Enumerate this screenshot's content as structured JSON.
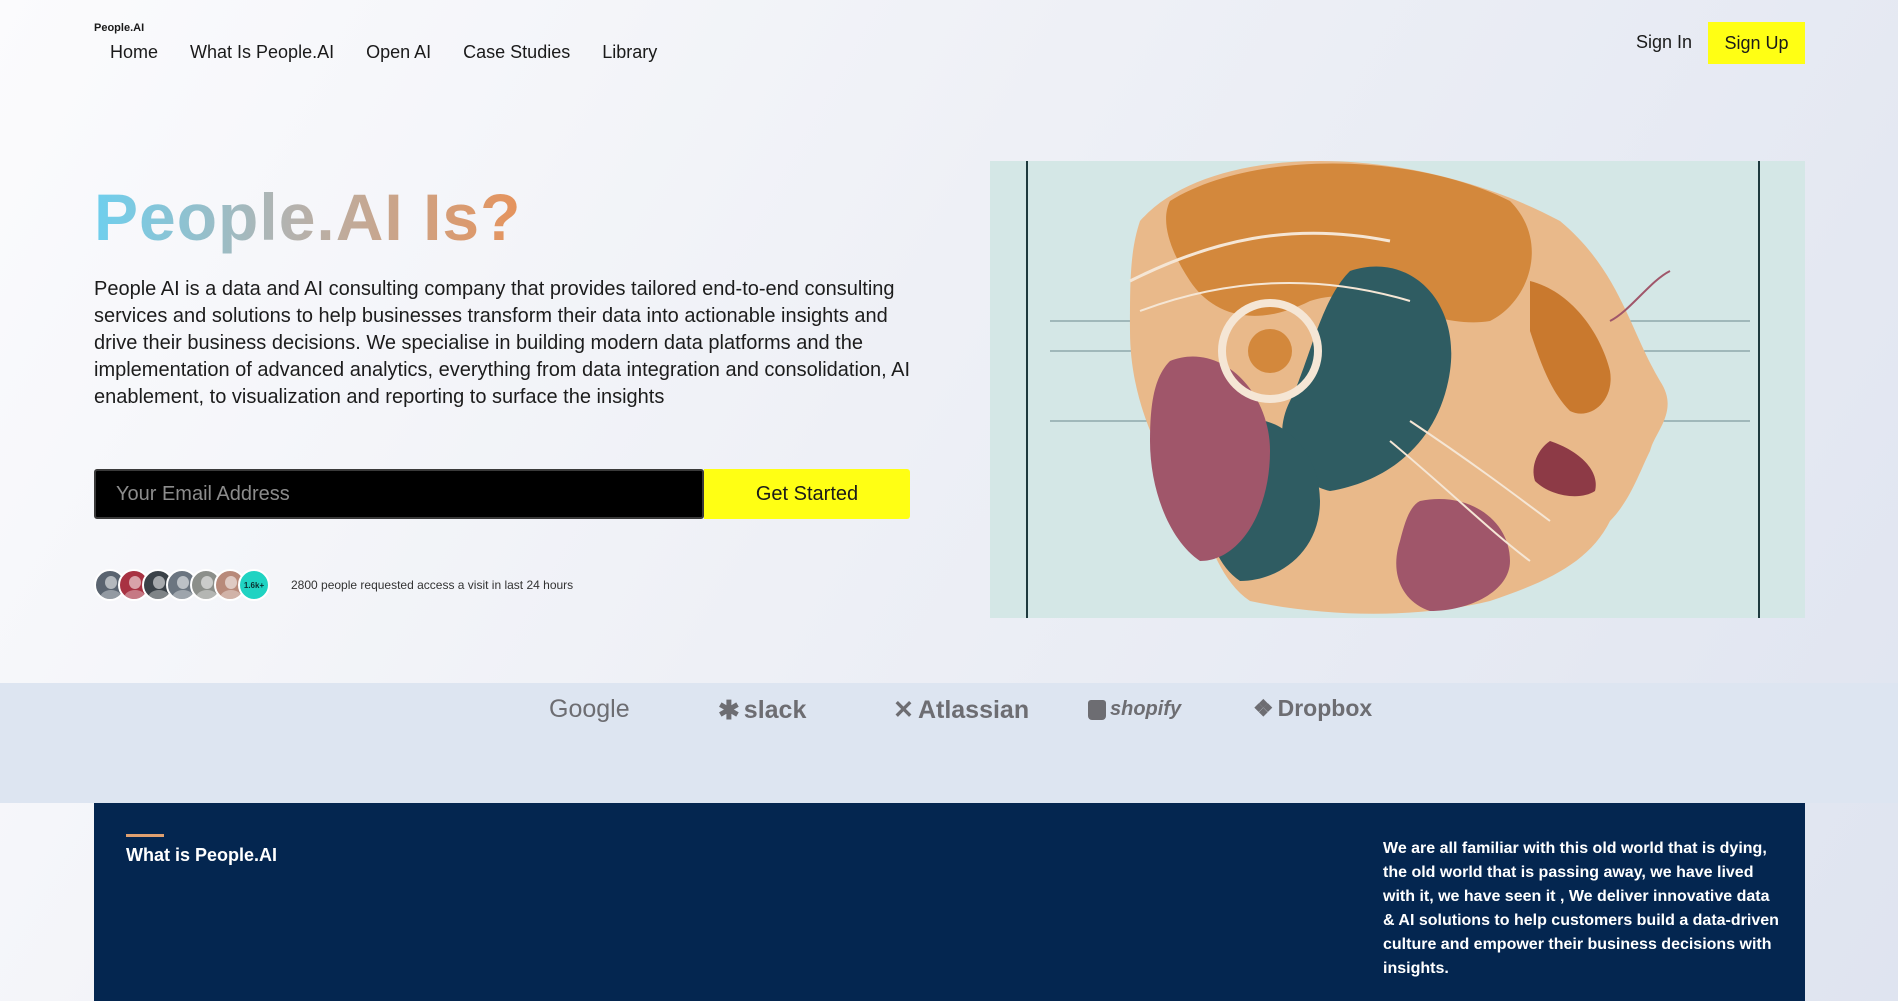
{
  "header": {
    "brand": "People.AI",
    "nav": [
      "Home",
      "What Is People.AI",
      "Open AI",
      "Case Studies",
      "Library"
    ],
    "sign_in": "Sign In",
    "sign_up": "Sign Up"
  },
  "hero": {
    "title": "People.AI Is?",
    "description": "People AI is a data and AI consulting company that provides tailored end-to-end consulting services and solutions to help businesses transform their data into actionable insights and drive their business decisions. We specialise in building modern data platforms and the implementation of advanced analytics, everything from data integration and consolidation, AI enablement, to visualization and reporting to surface the insights",
    "email_placeholder": "Your Email Address",
    "cta": "Get Started",
    "avatar_count": "1.6k+",
    "access_text": "2800 people requested access a visit in last 24 hours"
  },
  "logos": [
    "Google",
    "slack",
    "Atlassian",
    "shopify",
    "Dropbox"
  ],
  "about": {
    "title": "What is People.AI",
    "body": "We are all familiar with this old world that is dying, the old world that is passing away, we have lived with it, we have seen it , We deliver innovative data & AI solutions to help customers build a data-driven culture and empower their business decisions with insights."
  },
  "colors": {
    "accent_yellow": "#ffff14",
    "dark_navy": "#042650",
    "avatar_teal": "#20d3c2"
  }
}
